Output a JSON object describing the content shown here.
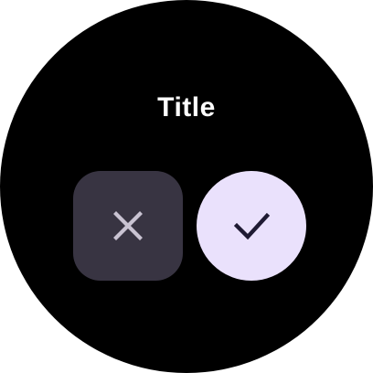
{
  "dialog": {
    "title": "Title",
    "cancel_button": {
      "icon": "close-icon",
      "background_color": "#383442",
      "icon_color": "#c9c3d2"
    },
    "confirm_button": {
      "icon": "check-icon",
      "background_color": "#eae1fc",
      "icon_color": "#1f1a33"
    }
  },
  "colors": {
    "screen_background": "#000000",
    "title_color": "#ffffff"
  }
}
